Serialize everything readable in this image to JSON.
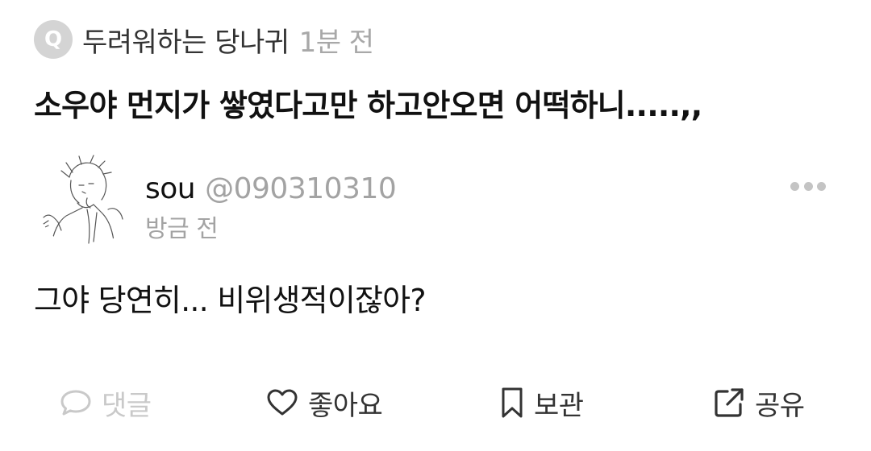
{
  "question": {
    "badge": "Q",
    "asker": "두려워하는 당나귀",
    "time": "1분 전",
    "text": "소우야 먼지가 쌓였다고만 하고안오면 어떡하니.....,,"
  },
  "answer": {
    "name": "sou",
    "handle": "@090310310",
    "time": "방금 전",
    "text": "그야 당연히... 비위생적이잖아?"
  },
  "actions": [
    {
      "label": "댓글",
      "icon": "comment-icon",
      "state": "disabled"
    },
    {
      "label": "좋아요",
      "icon": "heart-icon"
    },
    {
      "label": "보관",
      "icon": "bookmark-icon"
    },
    {
      "label": "공유",
      "icon": "share-icon"
    }
  ],
  "icons": {
    "more": "more-horizontal-icon"
  },
  "colors": {
    "text": "#111111",
    "secondary": "#a3a3a3",
    "badge_bg": "#d4d4d4",
    "disabled": "#c9c9c9"
  }
}
